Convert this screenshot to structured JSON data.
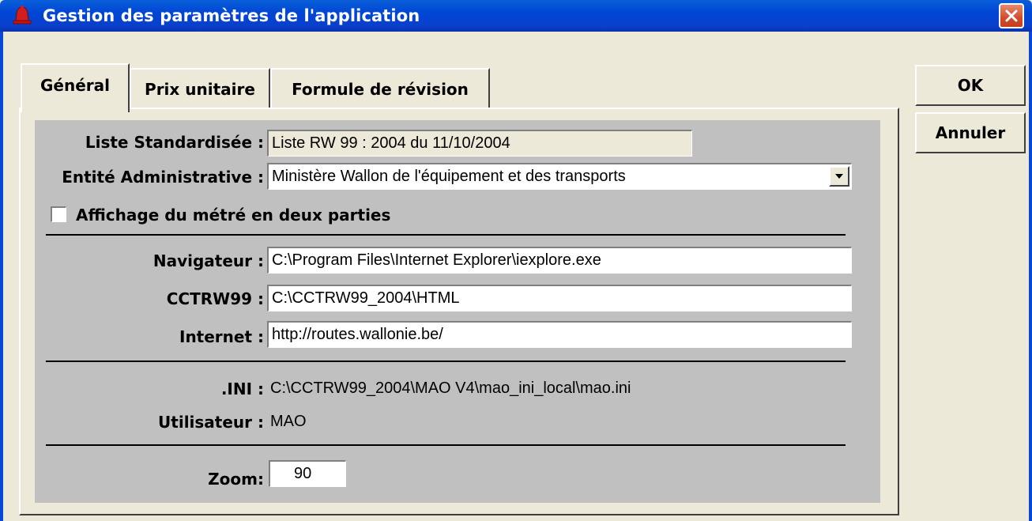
{
  "window": {
    "title": "Gestion des paramètres de l'application",
    "icon": "app-bell-icon",
    "close_icon": "close-icon"
  },
  "tabs": [
    {
      "label": "Général",
      "active": true
    },
    {
      "label": "Prix unitaire",
      "active": false
    },
    {
      "label": "Formule de révision",
      "active": false
    }
  ],
  "buttons": {
    "ok": "OK",
    "cancel": "Annuler"
  },
  "general": {
    "liste_label": "Liste Standardisée :",
    "liste_value": "Liste RW 99 : 2004 du 11/10/2004",
    "entite_label": "Entité Administrative :",
    "entite_value": "Ministère Wallon de l'équipement et des transports",
    "affichage_label": "Affichage du métré en deux parties",
    "affichage_checked": false,
    "navigateur_label": "Navigateur :",
    "navigateur_value": "C:\\Program Files\\Internet Explorer\\iexplore.exe",
    "cctrw_label": "CCTRW99 :",
    "cctrw_value": "C:\\CCTRW99_2004\\HTML",
    "internet_label": "Internet :",
    "internet_value": "http://routes.wallonie.be/",
    "ini_label": ".INI :",
    "ini_value": "C:\\CCTRW99_2004\\MAO V4\\mao_ini_local\\mao.ini",
    "utilisateur_label": "Utilisateur :",
    "utilisateur_value": "MAO",
    "zoom_label": "Zoom:",
    "zoom_value": "90"
  },
  "colors": {
    "titlebar": "#0046d5",
    "face": "#ece9d8",
    "panel_gray": "#c0c0c0",
    "close": "#d24b2b"
  }
}
